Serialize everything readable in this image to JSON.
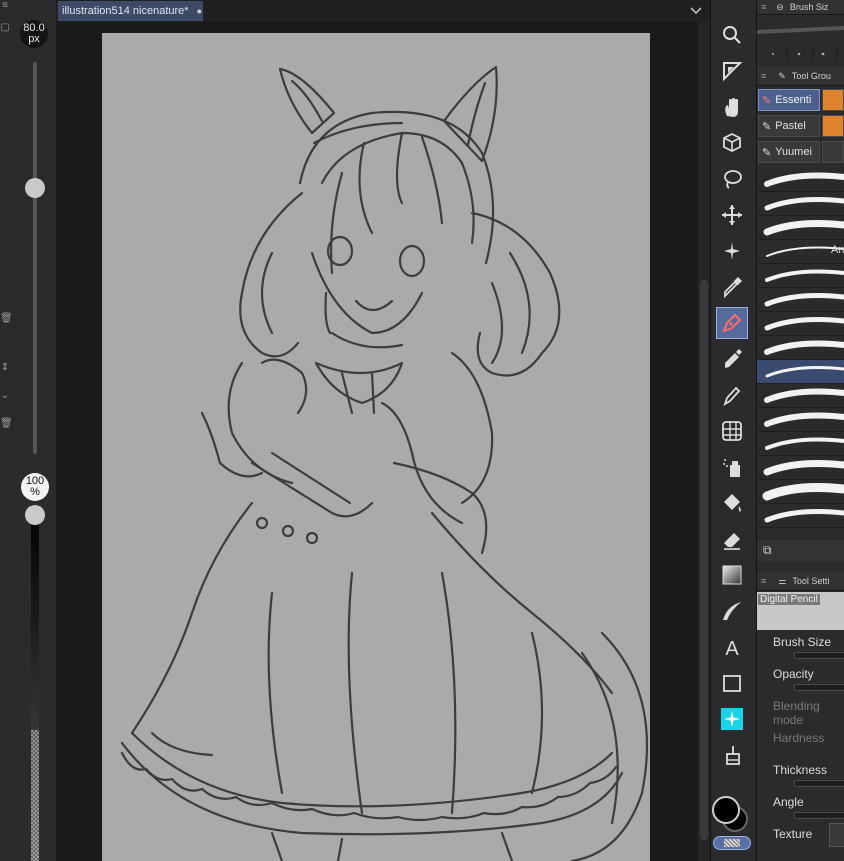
{
  "document_tab": {
    "title": "illustration514 nicenature*",
    "modified_dot": "●"
  },
  "brush_size_indicator": {
    "value": "80.0",
    "unit": "px",
    "slider_fraction": 0.7
  },
  "opacity_indicator": {
    "value": "100",
    "unit": "%",
    "slider_fraction": 1.0
  },
  "toolbar": {
    "tools": [
      {
        "name": "zoom",
        "icon": "magnifier-icon"
      },
      {
        "name": "operation",
        "icon": "object-select-icon"
      },
      {
        "name": "move",
        "icon": "hand-icon"
      },
      {
        "name": "3d-camera",
        "icon": "cube-icon"
      },
      {
        "name": "lasso",
        "icon": "lasso-icon"
      },
      {
        "name": "move-layer",
        "icon": "move-arrows-icon"
      },
      {
        "name": "auto-select",
        "icon": "magic-wand-icon"
      },
      {
        "name": "eyedropper",
        "icon": "eyedropper-icon"
      },
      {
        "name": "pen",
        "icon": "pen-icon",
        "active": true
      },
      {
        "name": "pencil",
        "icon": "marker-icon"
      },
      {
        "name": "brush",
        "icon": "brush-icon"
      },
      {
        "name": "decoration",
        "icon": "grid-icon"
      },
      {
        "name": "airbrush",
        "icon": "spray-icon"
      },
      {
        "name": "fill",
        "icon": "bucket-icon"
      },
      {
        "name": "eraser",
        "icon": "eraser-icon"
      },
      {
        "name": "gradient",
        "icon": "gradient-icon"
      },
      {
        "name": "blend",
        "icon": "blend-icon"
      },
      {
        "name": "text",
        "icon": "text-icon"
      },
      {
        "name": "figure",
        "icon": "rectangle-icon"
      },
      {
        "name": "cyan-sparkle",
        "icon": "sparkle-icon"
      },
      {
        "name": "spray-fill",
        "icon": "fill-spray-icon"
      }
    ],
    "main_color": "#000000",
    "sub_color": "#000000"
  },
  "brush_size_panel": {
    "title": "Brush Siz"
  },
  "tool_group_panel": {
    "title": "Tool Grou",
    "groups": [
      {
        "label": "Essenti",
        "icon": "pen-icon",
        "selected": true
      },
      {
        "label": "Pastel",
        "icon": "pencil-icon",
        "selected": false
      },
      {
        "label": "Yuumei",
        "icon": "pen-icon",
        "selected": false
      }
    ],
    "side_colors": [
      "#e0832e",
      "#e0832e",
      "#3a3a3c"
    ],
    "strokes_count": 15,
    "selected_stroke": 8,
    "stroke_4_label": "An"
  },
  "tool_settings_panel": {
    "title": "Tool Setti",
    "preview_label": "Digital Pencil",
    "properties": [
      {
        "label": "Brush Size",
        "enabled": true
      },
      {
        "label": "Opacity",
        "enabled": true
      },
      {
        "label": "Blending mode",
        "enabled": false
      },
      {
        "label": "Hardness",
        "enabled": false
      },
      {
        "label": "Thickness",
        "enabled": true
      },
      {
        "label": "Angle",
        "enabled": true
      },
      {
        "label": "Texture",
        "enabled": true
      }
    ]
  }
}
